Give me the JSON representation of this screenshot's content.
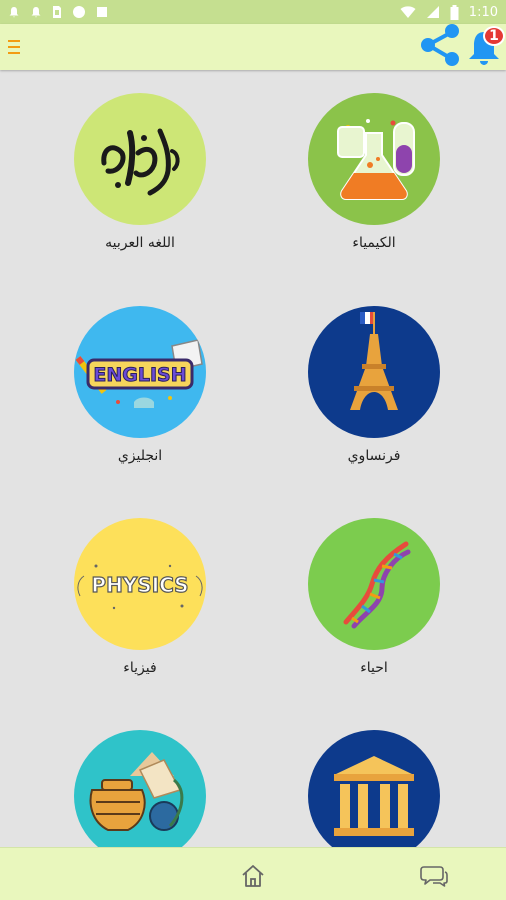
{
  "status_bar": {
    "time": "1:10"
  },
  "header": {
    "notification_count": "1",
    "icons": {
      "menu": "menu-icon",
      "share": "share-icon",
      "bell": "bell-icon"
    }
  },
  "subjects": [
    {
      "label": "الكيمياء",
      "icon": "chemistry-flasks",
      "color": "#8bc34a"
    },
    {
      "label": "اللغه العربيه",
      "icon": "arabic-calligraphy",
      "color": "#cde676"
    },
    {
      "label": "فرنساوي",
      "icon": "eiffel-tower",
      "color": "#0d3a8c"
    },
    {
      "label": "انجليزي",
      "icon": "english-book",
      "color": "#3fb8ef"
    },
    {
      "label": "احياء",
      "icon": "dna-helix",
      "color": "#7ccc4e"
    },
    {
      "label": "فيزياء",
      "icon": "physics-text",
      "color": "#fde05a"
    },
    {
      "label": "",
      "icon": "greek-temple",
      "color": "#0d3a8c"
    },
    {
      "label": "",
      "icon": "history-artifacts",
      "color": "#2fc3c9"
    }
  ],
  "bottom_nav": {
    "icons": {
      "home": "home-icon",
      "chat": "chat-icon"
    }
  },
  "colors": {
    "status_bar": "#c5df90",
    "app_bar": "#e9f7bd",
    "background": "#e3e3e3",
    "accent": "#2196f3",
    "badge": "#e53935"
  }
}
